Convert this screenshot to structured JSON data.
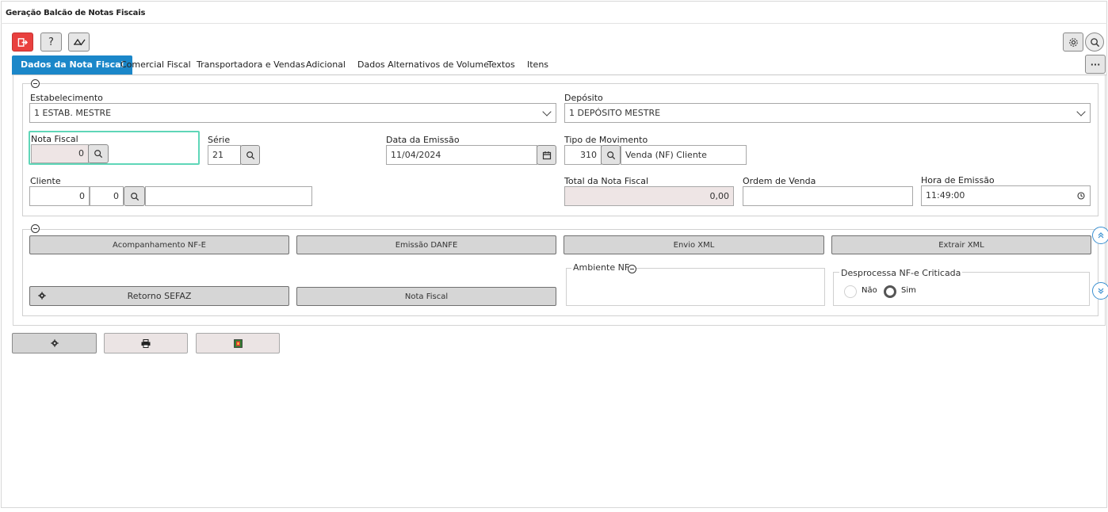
{
  "window": {
    "title": "Geração Balcão de Notas Fiscais"
  },
  "toolbar": {
    "exit_icon": "exit-icon",
    "help_label": "?",
    "sign_icon": "sign-pen-icon",
    "settings_icon": "gear-icon",
    "search_icon": "search-icon",
    "more_label": "···"
  },
  "tabs": [
    {
      "label": "Dados da Nota Fiscal",
      "active": true
    },
    {
      "label": "Comercial Fiscal"
    },
    {
      "label": "Transportadora e Vendas"
    },
    {
      "label": "Adicional"
    },
    {
      "label": "Dados Alternativos de Volume"
    },
    {
      "label": "Textos"
    },
    {
      "label": "Itens"
    }
  ],
  "form": {
    "estabelecimento": {
      "label": "Estabelecimento",
      "value": "1 ESTAB. MESTRE"
    },
    "deposito": {
      "label": "Depósito",
      "value": "1 DEPÓSITO MESTRE"
    },
    "nota_fiscal": {
      "label": "Nota Fiscal",
      "value": "0"
    },
    "serie": {
      "label": "Série",
      "value": "21"
    },
    "data_emissao": {
      "label": "Data da Emissão",
      "value": "11/04/2024"
    },
    "tipo_movimento": {
      "label": "Tipo de Movimento",
      "code": "310",
      "description": "Venda (NF) Cliente"
    },
    "cliente": {
      "label": "Cliente",
      "code1": "0",
      "code2": "0",
      "name": ""
    },
    "total_nf": {
      "label": "Total da Nota Fiscal",
      "value": "0,00"
    },
    "ordem_venda": {
      "label": "Ordem de Venda",
      "value": ""
    },
    "hora_emissao": {
      "label": "Hora de Emissão",
      "value": "11:49:00"
    }
  },
  "actions": {
    "acompanhamento": "Acompanhamento NF-E",
    "emissao_danfe": "Emissão DANFE",
    "envio_xml": "Envio XML",
    "extrair_xml": "Extrair XML",
    "retorno_sefaz": "Retorno SEFAZ",
    "nota_fiscal": "Nota Fiscal",
    "ambiente_label": "Ambiente NFe",
    "desprocessa_label": "Desprocessa NF-e Criticada",
    "radio_nao": "Não",
    "radio_sim": "Sim",
    "selected": "Sim"
  },
  "colors": {
    "accent": "#1b87c9",
    "exit": "#e9403e",
    "focus": "#5fd6b8"
  }
}
